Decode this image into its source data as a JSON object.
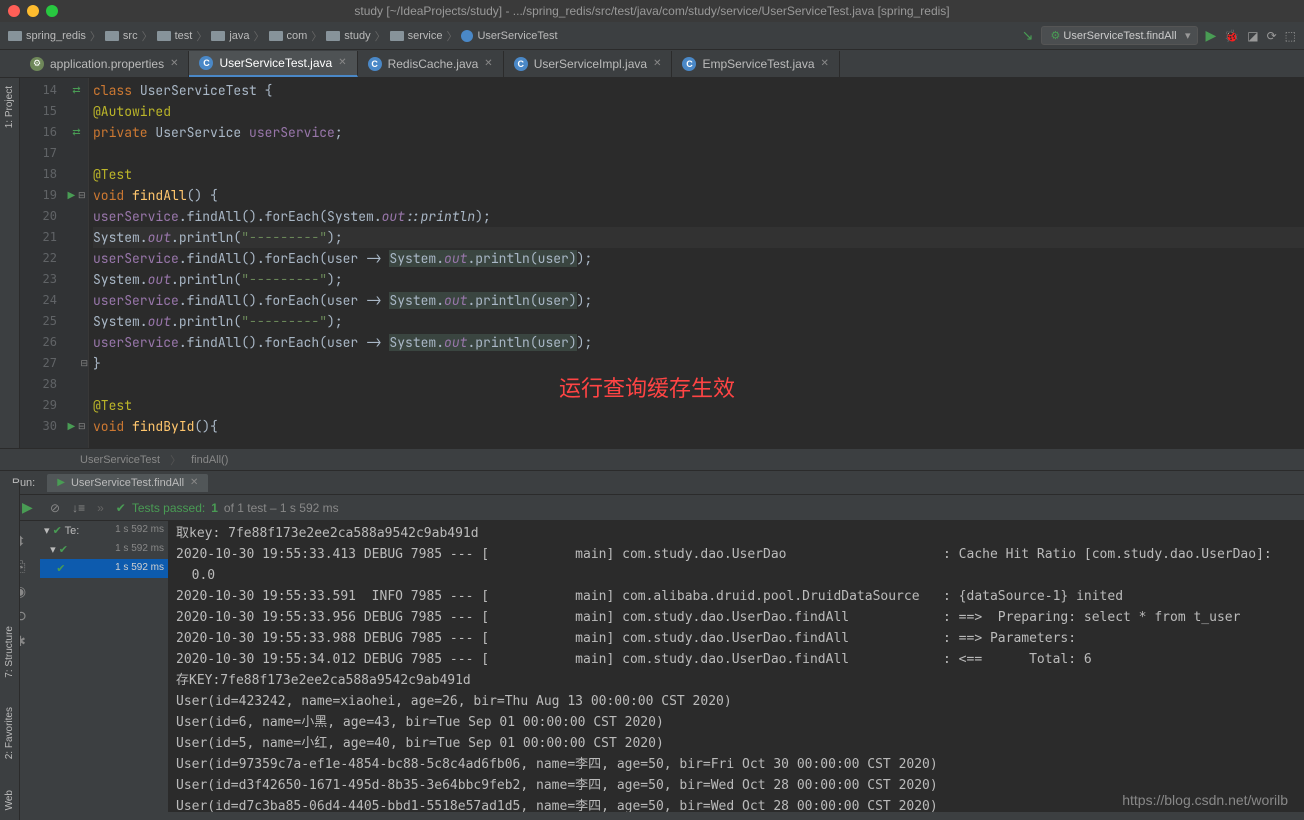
{
  "window": {
    "title": "study [~/IdeaProjects/study] - .../spring_redis/src/test/java/com/study/service/UserServiceTest.java [spring_redis]"
  },
  "breadcrumbs": [
    "spring_redis",
    "src",
    "test",
    "java",
    "com",
    "study",
    "service",
    "UserServiceTest"
  ],
  "run_config": "UserServiceTest.findAll",
  "tabs": [
    {
      "label": "application.properties",
      "type": "cfg",
      "active": false
    },
    {
      "label": "UserServiceTest.java",
      "type": "cls",
      "active": true
    },
    {
      "label": "RedisCache.java",
      "type": "cls",
      "active": false
    },
    {
      "label": "UserServiceImpl.java",
      "type": "cls",
      "active": false
    },
    {
      "label": "EmpServiceTest.java",
      "type": "cls",
      "active": false
    }
  ],
  "line_numbers": [
    "14",
    "15",
    "16",
    "17",
    "18",
    "19",
    "20",
    "21",
    "22",
    "23",
    "24",
    "25",
    "26",
    "27",
    "28",
    "29",
    "30",
    ""
  ],
  "annotation": "运行查询缓存生效",
  "editor_breadcrumb": [
    "UserServiceTest",
    "findAll()"
  ],
  "left_tabs": [
    "1: Project"
  ],
  "left_bottom_tabs": [
    "7: Structure",
    "2: Favorites",
    "Web"
  ],
  "run_panel": {
    "label": "Run:",
    "tab": "UserServiceTest.findAll",
    "test_status_prefix": "Tests passed:",
    "test_status_count": "1",
    "test_status_suffix": "of 1 test – 1 s 592 ms"
  },
  "test_tree": [
    {
      "label": "Te:",
      "time": "1 s 592 ms",
      "selected": false,
      "level": 0
    },
    {
      "label": "",
      "time": "1 s 592 ms",
      "selected": false,
      "level": 1
    },
    {
      "label": "",
      "time": "1 s 592 ms",
      "selected": true,
      "level": 2
    }
  ],
  "console_lines": [
    "取key: 7fe88f173e2ee2ca588a9542c9ab491d",
    "2020-10-30 19:55:33.413 DEBUG 7985 --- [           main] com.study.dao.UserDao                    : Cache Hit Ratio [com.study.dao.UserDao]:",
    "  0.0",
    "2020-10-30 19:55:33.591  INFO 7985 --- [           main] com.alibaba.druid.pool.DruidDataSource   : {dataSource-1} inited",
    "2020-10-30 19:55:33.956 DEBUG 7985 --- [           main] com.study.dao.UserDao.findAll            : ==>  Preparing: select * from t_user",
    "2020-10-30 19:55:33.988 DEBUG 7985 --- [           main] com.study.dao.UserDao.findAll            : ==> Parameters: ",
    "2020-10-30 19:55:34.012 DEBUG 7985 --- [           main] com.study.dao.UserDao.findAll            : <==      Total: 6",
    "存KEY:7fe88f173e2ee2ca588a9542c9ab491d",
    "User(id=423242, name=xiaohei, age=26, bir=Thu Aug 13 00:00:00 CST 2020)",
    "User(id=6, name=小黑, age=43, bir=Tue Sep 01 00:00:00 CST 2020)",
    "User(id=5, name=小红, age=40, bir=Tue Sep 01 00:00:00 CST 2020)",
    "User(id=97359c7a-ef1e-4854-bc88-5c8c4ad6fb06, name=李四, age=50, bir=Fri Oct 30 00:00:00 CST 2020)",
    "User(id=d3f42650-1671-495d-8b35-3e64bbc9feb2, name=李四, age=50, bir=Wed Oct 28 00:00:00 CST 2020)",
    "User(id=d7c3ba85-06d4-4405-bbd1-5518e57ad1d5, name=李四, age=50, bir=Wed Oct 28 00:00:00 CST 2020)"
  ],
  "watermark": "https://blog.csdn.net/worilb"
}
